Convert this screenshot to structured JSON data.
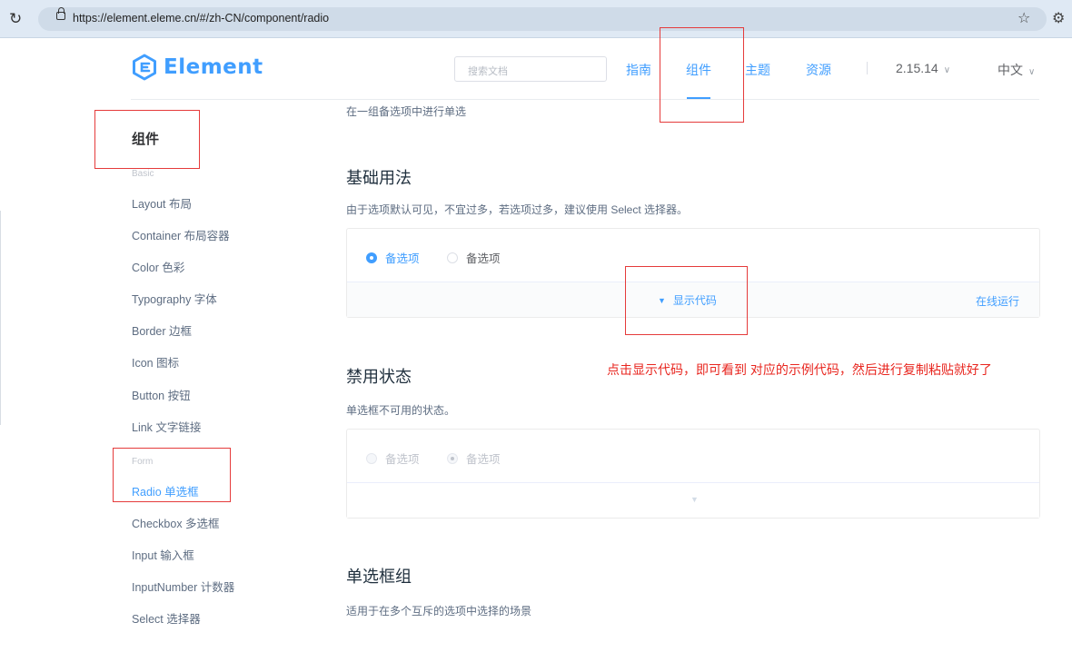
{
  "browser": {
    "url": "https://element.eleme.cn/#/zh-CN/component/radio"
  },
  "header": {
    "logo_text": "Element",
    "search_placeholder": "搜索文档",
    "nav": {
      "guide": "指南",
      "component": "组件",
      "theme": "主题",
      "resource": "资源",
      "version": "2.15.14",
      "language": "中文"
    }
  },
  "sidebar": {
    "title": "组件",
    "group_basic": "Basic",
    "basic_items": [
      "Layout 布局",
      "Container 布局容器",
      "Color 色彩",
      "Typography 字体",
      "Border 边框",
      "Icon 图标",
      "Button 按钮",
      "Link 文字链接"
    ],
    "group_form": "Form",
    "form_items": [
      "Radio 单选框",
      "Checkbox 多选框",
      "Input 输入框",
      "InputNumber 计数器",
      "Select 选择器"
    ],
    "active_item": "Radio 单选框"
  },
  "main": {
    "intro": "在一组备选项中进行单选",
    "basic": {
      "title": "基础用法",
      "desc": "由于选项默认可见，不宜过多，若选项过多，建议使用 Select 选择器。",
      "radio1": "备选项",
      "radio2": "备选项",
      "show_code": "显示代码",
      "run_online": "在线运行"
    },
    "disabled": {
      "title": "禁用状态",
      "desc": "单选框不可用的状态。",
      "radio1": "备选项",
      "radio2": "备选项"
    },
    "group": {
      "title": "单选框组",
      "desc": "适用于在多个互斥的选项中选择的场景"
    }
  },
  "annotation": {
    "text": "点击显示代码，即可看到 对应的示例代码，然后进行复制粘贴就好了",
    "color": "#e8261f"
  },
  "colors": {
    "accent": "#409eff",
    "highlight_box": "#e53b3b"
  }
}
